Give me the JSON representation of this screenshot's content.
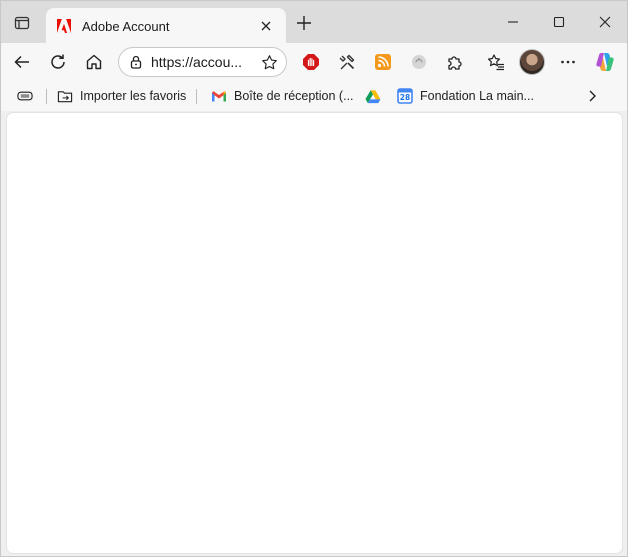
{
  "tab": {
    "title": "Adobe Account",
    "brand_color": "#eb1000"
  },
  "addressbar": {
    "url": "https://accou..."
  },
  "bookmarks": [
    {
      "label": "Importer les favoris",
      "icon": "import-favorites-icon"
    },
    {
      "label": "Boîte de réception (...",
      "icon": "gmail-icon"
    },
    {
      "label": "",
      "icon": "google-drive-icon"
    },
    {
      "label": "Fondation La main...",
      "icon": "google-calendar-icon",
      "calendar_day": "28"
    }
  ],
  "colors": {
    "titlebar": "#dcdcdc",
    "toolbar": "#f7f7f7",
    "content": "#ffffff"
  }
}
